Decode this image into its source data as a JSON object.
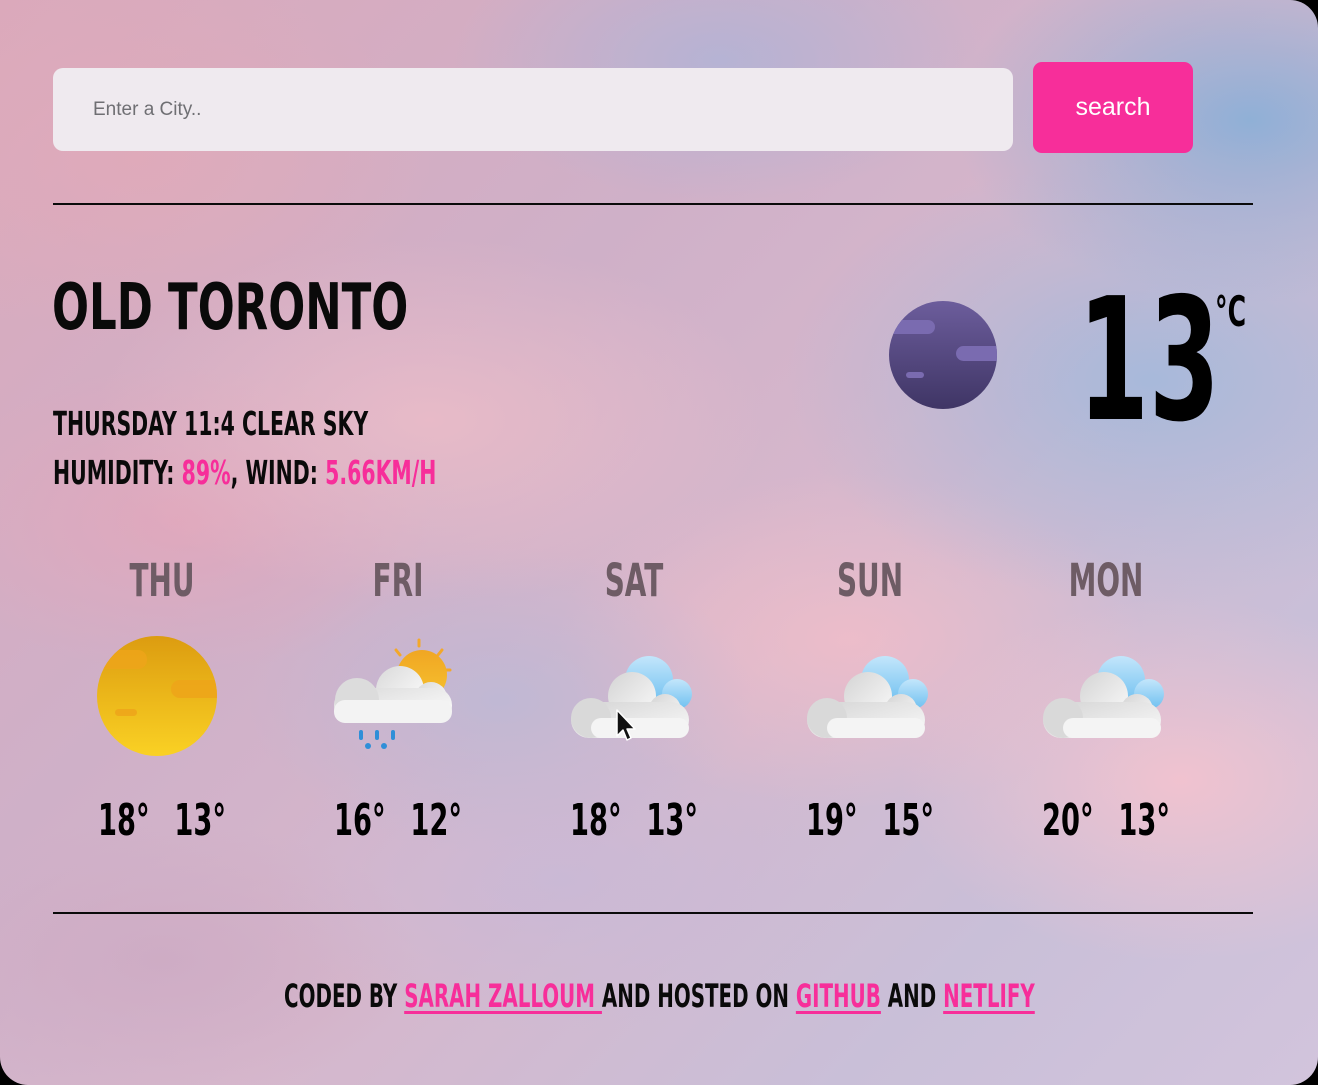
{
  "search": {
    "placeholder": "Enter a City..",
    "value": "",
    "button_label": "search"
  },
  "current": {
    "city": "Old Toronto",
    "day_time": "Thursday 11:4",
    "condition": "clear sky",
    "humidity_label": "Humidity: ",
    "humidity_value": "89%",
    "wind_label": ", Wind: ",
    "wind_value": "5.66km/h",
    "temperature": "13",
    "unit": "°C",
    "icon": "night-clear-moon-icon"
  },
  "forecast": [
    {
      "day": "Thu",
      "high": "18°",
      "low": "13°",
      "icon": "sun-icon"
    },
    {
      "day": "Fri",
      "high": "16°",
      "low": "12°",
      "icon": "sun-cloud-rain-icon"
    },
    {
      "day": "Sat",
      "high": "18°",
      "low": "13°",
      "icon": "cloudy-icon"
    },
    {
      "day": "Sun",
      "high": "19°",
      "low": "15°",
      "icon": "cloudy-icon"
    },
    {
      "day": "Mon",
      "high": "20°",
      "low": "13°",
      "icon": "cloudy-icon"
    }
  ],
  "footer": {
    "prefix": "Coded by ",
    "author_link": "Sarah Zalloum ",
    "middle": "and hosted on ",
    "github_link": "GitHub",
    "and": " and ",
    "netlify_link": "Netlify"
  },
  "colors": {
    "accent": "#f72e9a",
    "text": "#0a0a0a",
    "day_label": "#6e5c65",
    "input_bg": "#efeaef"
  }
}
